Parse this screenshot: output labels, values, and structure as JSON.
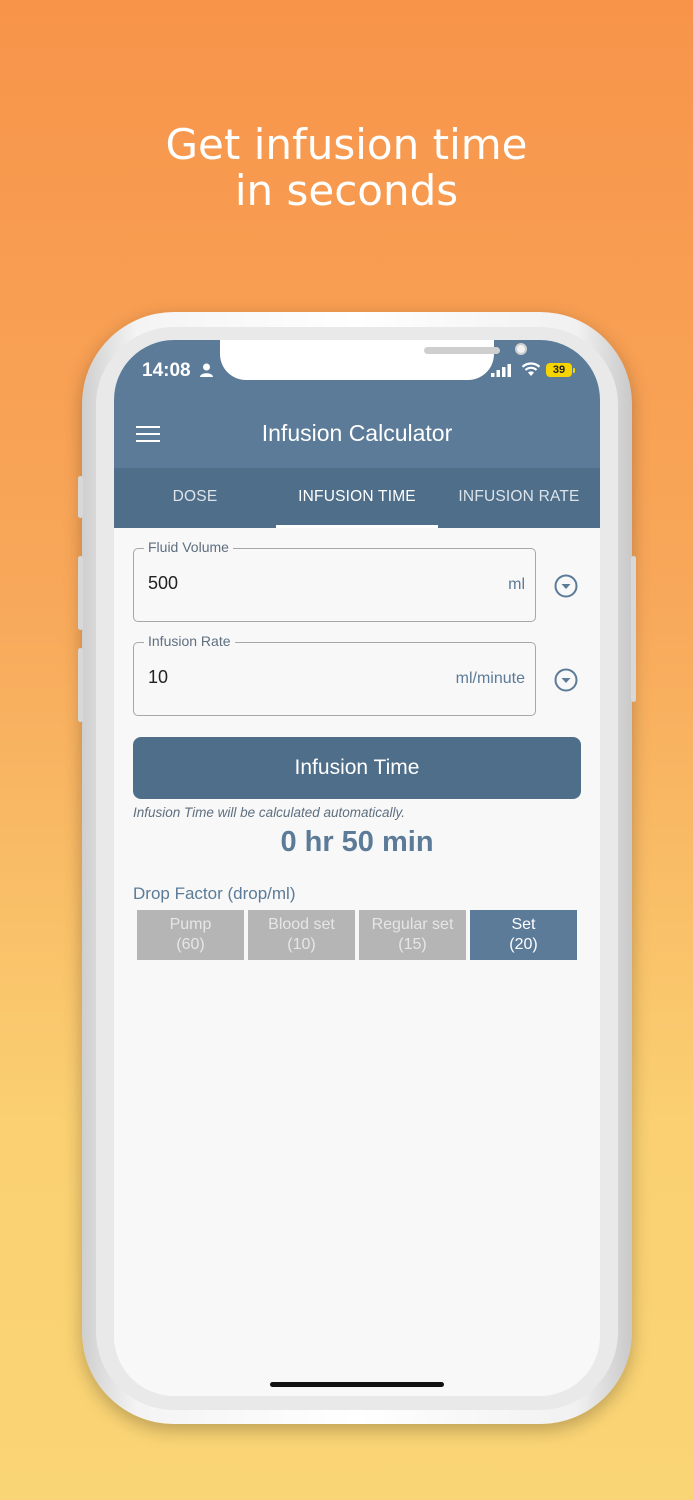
{
  "headline": {
    "line1": "Get infusion time",
    "line2": "in seconds"
  },
  "status_bar": {
    "time": "14:08",
    "battery": "39"
  },
  "app_bar": {
    "title": "Infusion Calculator"
  },
  "tabs": [
    {
      "label": "DOSE",
      "active": false
    },
    {
      "label": "INFUSION TIME",
      "active": true
    },
    {
      "label": "INFUSION RATE",
      "active": false
    }
  ],
  "fields": {
    "fluid_volume": {
      "label": "Fluid Volume",
      "value": "500",
      "unit": "ml"
    },
    "infusion_rate": {
      "label": "Infusion Rate",
      "value": "10",
      "unit": "ml/minute"
    }
  },
  "calculate_button": {
    "label": "Infusion Time"
  },
  "hint": "Infusion Time will be calculated automatically.",
  "result": "0 hr 50 min",
  "drop_factor": {
    "title": "Drop Factor (drop/ml)",
    "options": [
      {
        "line1": "Pump",
        "line2": "(60)",
        "selected": false
      },
      {
        "line1": "Blood set",
        "line2": "(10)",
        "selected": false
      },
      {
        "line1": "Regular set",
        "line2": "(15)",
        "selected": false
      },
      {
        "line1": "Set",
        "line2": "(20)",
        "selected": true
      }
    ]
  },
  "colors": {
    "primary": "#5B7B98",
    "tab_bar": "#4F6E89",
    "background_top": "#F7944A",
    "background_bottom": "#FAD575"
  }
}
